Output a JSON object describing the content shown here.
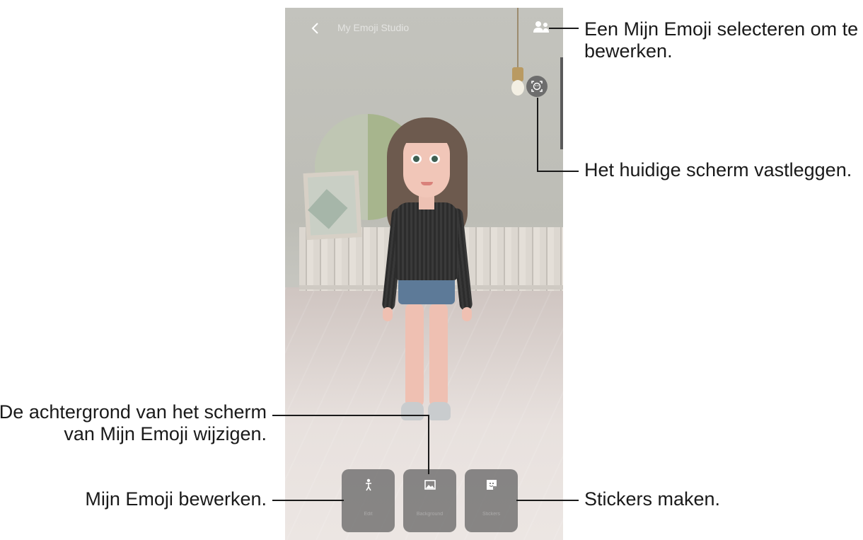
{
  "screen": {
    "title": "My Emoji Studio",
    "back_icon": "chevron-left-icon",
    "select_emoji_icon": "people-icon",
    "capture_icon": "face-capture-icon"
  },
  "menu": [
    {
      "label": "Edit",
      "icon": "person-icon"
    },
    {
      "label": "Background",
      "icon": "image-icon"
    },
    {
      "label": "Stickers",
      "icon": "sticker-icon"
    }
  ],
  "callouts": {
    "select_emoji": [
      "Een Mijn Emoji selecteren om te",
      "bewerken."
    ],
    "capture": "Het huidige scherm vastleggen.",
    "background": [
      "De achtergrond van het scherm",
      "van Mijn Emoji wijzigen."
    ],
    "edit": "Mijn Emoji bewerken.",
    "stickers": "Stickers maken."
  },
  "colors": {
    "callout_line": "#1a1a1a",
    "menu_button_bg": "#606060"
  }
}
